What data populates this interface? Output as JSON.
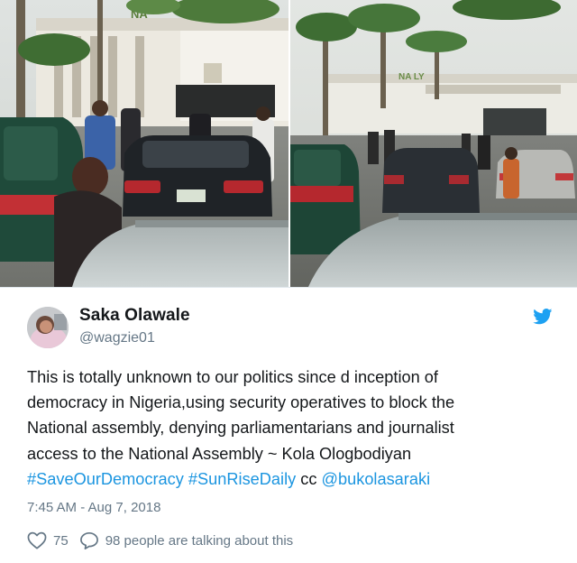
{
  "photos": {
    "left_sign_text": "NA",
    "right_sign_text": "NA    LY",
    "accent": "#1da1f2"
  },
  "tweet": {
    "display_name": "Saka Olawale",
    "handle": "@wagzie01",
    "text_lines": [
      "This is totally unknown to our politics since d inception of",
      "democracy in Nigeria,using security operatives to block the",
      "National assembly, denying parliamentarians and journalist",
      "access to the National Assembly ~ Kola Ologbodiyan"
    ],
    "hashtags": [
      "#SaveOurDemocracy",
      "#SunRiseDaily"
    ],
    "cc_text": "cc",
    "mention": "@bukolasaraki",
    "timestamp": "7:45 AM - Aug 7, 2018",
    "likes_count": "75",
    "replies_text": "98 people are talking about this",
    "icons": {
      "brand": "twitter-bird-icon",
      "like": "heart-icon",
      "reply": "speech-bubble-icon"
    },
    "colors": {
      "link": "#1b95e0",
      "muted": "#657786",
      "text": "#14171a",
      "brand": "#1da1f2"
    }
  }
}
